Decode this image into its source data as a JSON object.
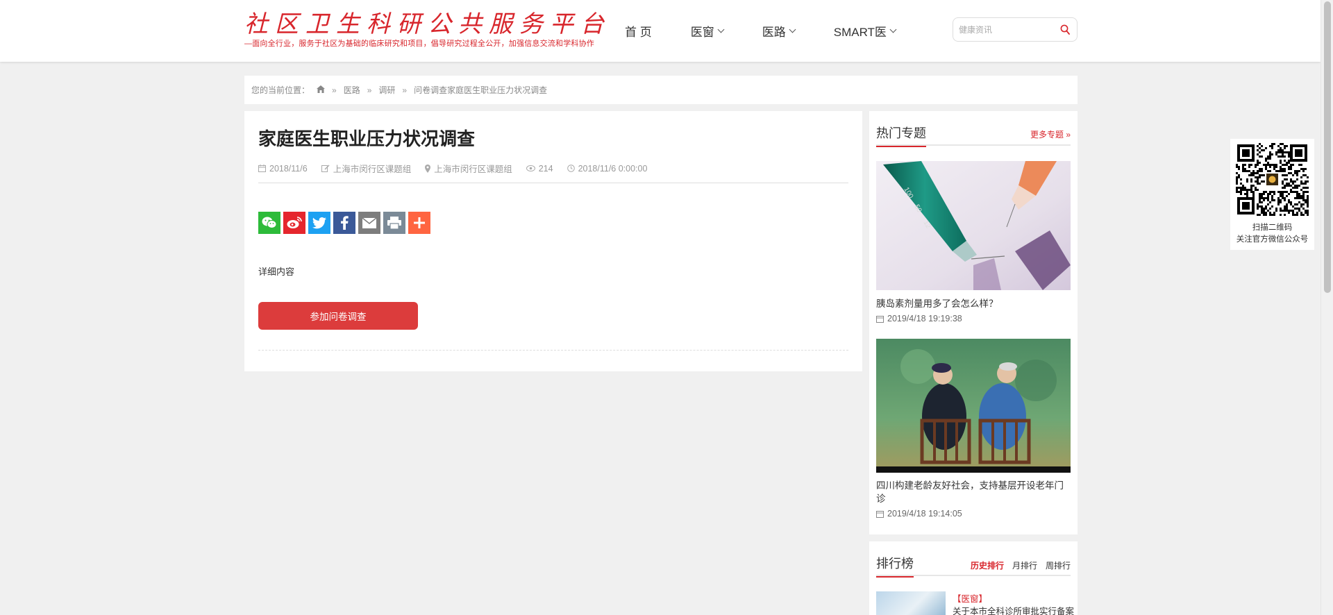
{
  "header": {
    "logo_title": "社区卫生科研公共服务平台",
    "logo_subtitle": "—面向全行业，服务于社区为基础的临床研究和项目，倡导研究过程全公开，加强信息交流和学科协作",
    "nav": [
      {
        "label": "首 页"
      },
      {
        "label": "医窗"
      },
      {
        "label": "医路"
      },
      {
        "label": "SMART医"
      }
    ],
    "search_placeholder": "健康资讯"
  },
  "breadcrumb": {
    "prefix": "您的当前位置：",
    "sep": "»",
    "items": [
      "医路",
      "调研",
      "问卷调查家庭医生职业压力状况调查"
    ]
  },
  "article": {
    "title": "家庭医生职业压力状况调查",
    "date": "2018/11/6",
    "author": "上海市闵行区课题组",
    "location": "上海市闵行区课题组",
    "views": "214",
    "datetime": "2018/11/6 0:00:00",
    "content": "详细内容",
    "join_button": "参加问卷调查",
    "share_colors": [
      "#2dbb3a",
      "#e5262d",
      "#1da1f2",
      "#3b5998",
      "#7d7d7d",
      "#7b8a97",
      "#ff6541"
    ]
  },
  "sidebar": {
    "hot_title": "热门专题",
    "more": "更多专题 »",
    "cards": [
      {
        "title": "胰岛素剂量用多了会怎么样？",
        "date": "2019/4/18 19:19:38"
      },
      {
        "title": "四川构建老龄友好社会，支持基层开设老年门诊",
        "date": "2019/4/18 19:14:05"
      }
    ],
    "rank_title": "排行榜",
    "rank_tabs": [
      "历史排行",
      "月排行",
      "周排行"
    ],
    "rank_item": {
      "category": "【医窗】",
      "title": "关于本市全科诊所审批实行备案"
    }
  },
  "qr": {
    "line1": "扫描二维码",
    "line2": "关注官方微信公众号"
  }
}
